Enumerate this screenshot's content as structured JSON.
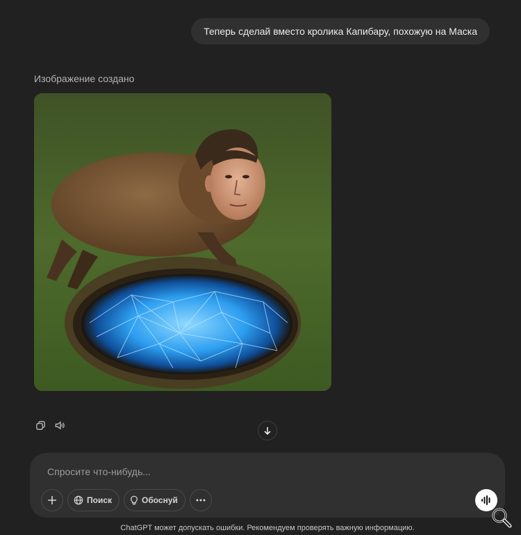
{
  "conversation": {
    "user_message": "Теперь сделай вместо кролика Капибару, похожую на Маска",
    "assistant_status": "Изображение создано"
  },
  "message_actions": {
    "copy_icon": "copy-icon",
    "read_aloud_icon": "speaker-icon"
  },
  "composer": {
    "placeholder": "Спросите что-нибудь...",
    "value": "",
    "add_icon": "plus-icon",
    "search_label": "Поиск",
    "search_icon": "globe-icon",
    "reason_label": "Обоснуй",
    "reason_icon": "lightbulb-icon",
    "more_icon": "ellipsis-icon",
    "voice_icon": "voice-waveform-icon"
  },
  "footer": {
    "disclaimer": "ChatGPT может допускать ошибки. Рекомендуем проверять важную информацию."
  },
  "colors": {
    "background": "#212121",
    "bubble": "#303030",
    "portal": "#2fa8ff"
  }
}
